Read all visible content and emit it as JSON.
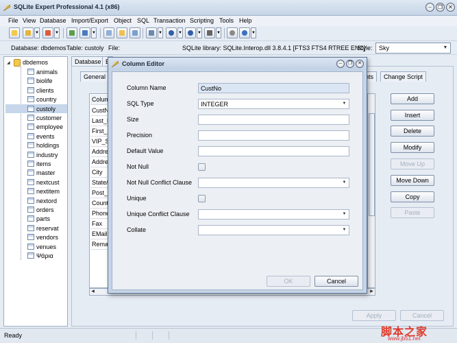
{
  "window": {
    "title": "SQLite Expert Professional 4.1 (x86)",
    "minimize": "–",
    "restore": "❐",
    "close": "✕"
  },
  "menu": [
    "File",
    "View",
    "Database",
    "Import/Export",
    "Object",
    "SQL",
    "Transaction",
    "Scripting",
    "Tools",
    "Help"
  ],
  "infobar": {
    "database": "Database: dbdemos",
    "table": "Table: custoly",
    "file": "File:",
    "library": "SQLite library: SQLite.Interop.dll 3.8.4.1 [FTS3 FTS4 RTREE ENC]",
    "style_label": "Style:",
    "style_value": "Sky"
  },
  "tree": {
    "root": "dbdemos",
    "selected": "custoly",
    "items": [
      "animals",
      "biolife",
      "clients",
      "country",
      "custoly",
      "customer",
      "employee",
      "events",
      "holdings",
      "industry",
      "items",
      "master",
      "nextcust",
      "nextitem",
      "nextord",
      "orders",
      "parts",
      "reservat",
      "vendors",
      "venues",
      "Ψάρια"
    ]
  },
  "tabs": {
    "database": "Database",
    "second": "E"
  },
  "inner_tabs": {
    "general": "General",
    "constraints": "ints",
    "change_script": "Change Script"
  },
  "grid": {
    "header": "Colum",
    "rows": [
      "CustN",
      "Last_N",
      "First_N",
      "VIP_St",
      "Addre",
      "Addre",
      "City",
      "State/",
      "Post_C",
      "Count",
      "Phone",
      "Fax",
      "EMail",
      "Remar"
    ],
    "null_header": "ull"
  },
  "right_buttons": [
    {
      "label": "Add",
      "enabled": true
    },
    {
      "label": "Insert",
      "enabled": true
    },
    {
      "label": "Delete",
      "enabled": true
    },
    {
      "label": "Modify",
      "enabled": true
    },
    {
      "label": "Move Up",
      "enabled": false
    },
    {
      "label": "Move Down",
      "enabled": true
    },
    {
      "label": "Copy",
      "enabled": true
    },
    {
      "label": "Paste",
      "enabled": false
    }
  ],
  "bottom_buttons": {
    "apply": "Apply",
    "cancel": "Cancel"
  },
  "dialog": {
    "title": "Column Editor",
    "fields": {
      "column_name": {
        "label": "Column Name",
        "value": "CustNo"
      },
      "sql_type": {
        "label": "SQL Type",
        "value": "INTEGER"
      },
      "size": {
        "label": "Size",
        "value": ""
      },
      "precision": {
        "label": "Precision",
        "value": ""
      },
      "default_value": {
        "label": "Default Value",
        "value": ""
      },
      "not_null": {
        "label": "Not Null",
        "checked": false
      },
      "not_null_conflict": {
        "label": "Not Null Conflict Clause",
        "value": ""
      },
      "unique": {
        "label": "Unique",
        "checked": false
      },
      "unique_conflict": {
        "label": "Unique Conflict Clause",
        "value": ""
      },
      "collate": {
        "label": "Collate",
        "value": ""
      }
    },
    "ok": "OK",
    "cancel": "Cancel"
  },
  "status": {
    "text": "Ready"
  },
  "watermark": {
    "main": "脚本之家",
    "url": "www.jb51.net"
  }
}
